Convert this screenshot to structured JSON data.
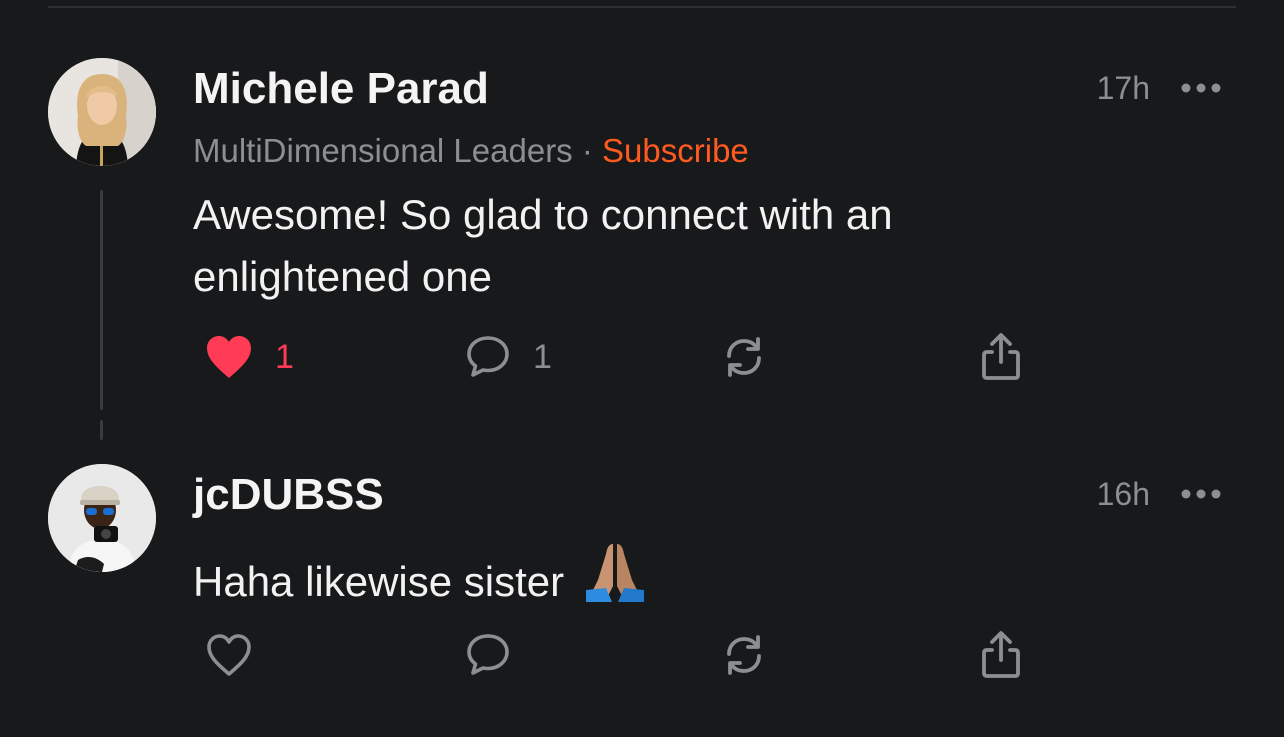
{
  "colors": {
    "background": "#18191b",
    "muted": "#8d8e92",
    "accent": "#ff5a1f",
    "like": "#ff3b55"
  },
  "comments": [
    {
      "author": "Michele Parad",
      "publication": "MultiDimensional Leaders",
      "separator": "·",
      "subscribe_label": "Subscribe",
      "time": "17h",
      "text": "Awesome! So glad to connect with an enlightened one",
      "liked": true,
      "like_count": "1",
      "reply_count": "1",
      "icons": [
        "heart-filled-icon",
        "comment-icon",
        "restack-icon",
        "share-icon",
        "more-icon"
      ]
    },
    {
      "author": "jcDUBSS",
      "time": "16h",
      "text": "Haha likewise sister",
      "emoji": "folded-hands-emoji",
      "liked": false,
      "icons": [
        "heart-outline-icon",
        "comment-icon",
        "restack-icon",
        "share-icon",
        "more-icon"
      ]
    }
  ]
}
